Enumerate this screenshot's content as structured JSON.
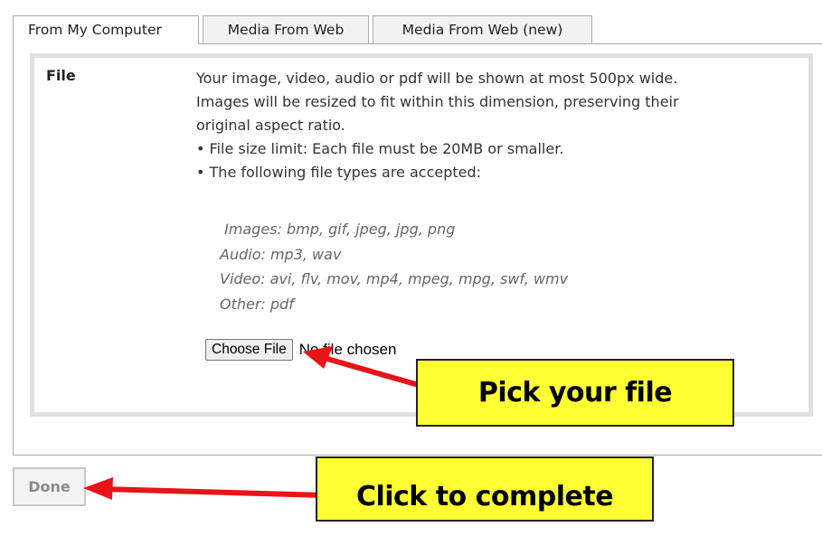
{
  "tabs": [
    {
      "label": "From My Computer",
      "active": true
    },
    {
      "label": "Media From Web",
      "active": false
    },
    {
      "label": "Media From Web (new)",
      "active": false
    }
  ],
  "file_section": {
    "label": "File",
    "description": [
      "Your image, video, audio or pdf will be shown at most 500px wide.",
      "Images will be resized to fit within this dimension, preserving their",
      "original aspect ratio.",
      "• File size limit: Each file must be 20MB or smaller.",
      "• The following file types are accepted:"
    ],
    "types": [
      " Images: bmp, gif, jpeg, jpg, png",
      "Audio: mp3, wav",
      "Video: avi, flv, mov, mp4, mpeg, mpg, swf, wmv",
      "Other: pdf"
    ],
    "choose_button": "Choose File",
    "no_file_text": "No file chosen"
  },
  "done_button": "Done",
  "annotations": {
    "pick_file": "Pick your file",
    "click_complete": "Click to complete",
    "arrow_color": "#e8141a",
    "callout_color": "#ffff33"
  }
}
